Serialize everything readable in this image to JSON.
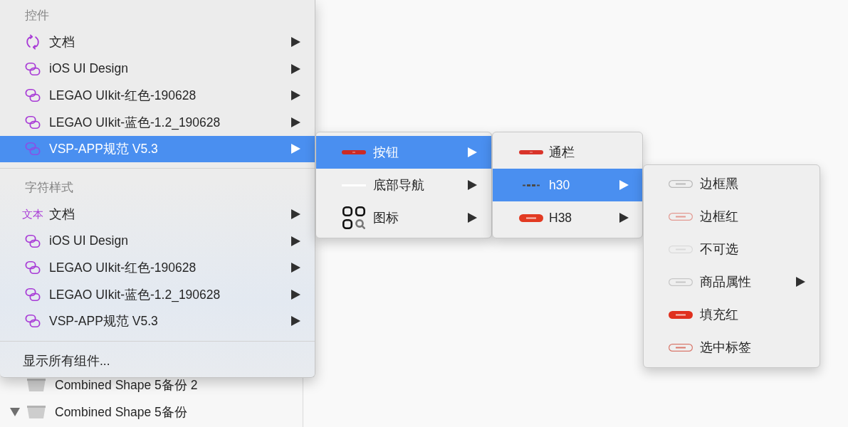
{
  "context_menu": {
    "sections": [
      {
        "header": "控件",
        "items": [
          {
            "label": "文档",
            "kind": "sync",
            "has_submenu": true,
            "selected": false
          },
          {
            "label": "iOS UI Design",
            "kind": "library",
            "has_submenu": true,
            "selected": false
          },
          {
            "label": "LEGAO UIkit-红色-190628",
            "kind": "library",
            "has_submenu": true,
            "selected": false
          },
          {
            "label": "LEGAO UIkit-蓝色-1.2_190628",
            "kind": "library",
            "has_submenu": true,
            "selected": false
          },
          {
            "label": "VSP-APP规范 V5.3",
            "kind": "library",
            "has_submenu": true,
            "selected": true
          }
        ]
      },
      {
        "header": "字符样式",
        "items": [
          {
            "label": "文档",
            "kind": "text",
            "icon_text": "文本",
            "has_submenu": true,
            "selected": false
          },
          {
            "label": "iOS UI Design",
            "kind": "library",
            "has_submenu": true,
            "selected": false
          },
          {
            "label": "LEGAO UIkit-红色-190628",
            "kind": "library",
            "has_submenu": true,
            "selected": false
          },
          {
            "label": "LEGAO UIkit-蓝色-1.2_190628",
            "kind": "library",
            "has_submenu": true,
            "selected": false
          },
          {
            "label": "VSP-APP规范 V5.3",
            "kind": "library",
            "has_submenu": true,
            "selected": false
          }
        ]
      }
    ],
    "footer_items": [
      {
        "label": "显示所有组件...",
        "selected": false
      }
    ]
  },
  "submenus": [
    {
      "items": [
        {
          "label": "按钮",
          "kind": "bar",
          "color": "#cc2a24",
          "has_submenu": true,
          "selected": true
        },
        {
          "label": "底部导航",
          "kind": "line",
          "color": "#ffffff",
          "has_submenu": true,
          "selected": false
        },
        {
          "label": "图标",
          "kind": "grid",
          "has_submenu": true,
          "selected": false
        }
      ]
    },
    {
      "items": [
        {
          "label": "通栏",
          "kind": "bar",
          "color": "#d9342a",
          "has_submenu": false,
          "selected": false
        },
        {
          "label": "h30",
          "kind": "dots",
          "color": "#4a4a4a",
          "has_submenu": true,
          "selected": true
        },
        {
          "label": "H38",
          "kind": "pill",
          "color": "#e23a22",
          "has_submenu": true,
          "selected": false
        }
      ]
    },
    {
      "items": [
        {
          "label": "边框黑",
          "kind": "outline",
          "color": "#b9b9b9",
          "has_submenu": false,
          "selected": false
        },
        {
          "label": "边框红",
          "kind": "outline",
          "color": "#e39a92",
          "has_submenu": false,
          "selected": false
        },
        {
          "label": "不可选",
          "kind": "outline",
          "color": "#dadada",
          "has_submenu": false,
          "selected": false
        },
        {
          "label": "商品属性",
          "kind": "outline",
          "color": "#c6c6c6",
          "has_submenu": true,
          "selected": false
        },
        {
          "label": "填充红",
          "kind": "pill",
          "color": "#e0301e",
          "has_submenu": false,
          "selected": false
        },
        {
          "label": "选中标签",
          "kind": "outline",
          "color": "#d9786c",
          "has_submenu": false,
          "selected": false
        }
      ]
    }
  ],
  "layers": [
    {
      "name": "Combined Shape 5备份 2"
    },
    {
      "name": "Combined Shape 5备份",
      "expanded": true
    }
  ]
}
